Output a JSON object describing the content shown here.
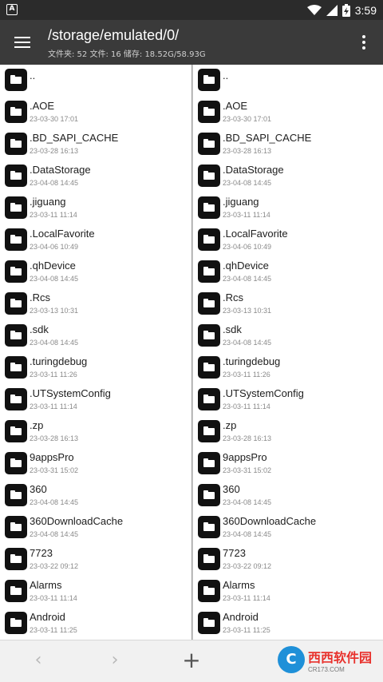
{
  "status_bar": {
    "time": "3:59",
    "left_icon": "A"
  },
  "toolbar": {
    "path": "/storage/emulated/0/",
    "info": "文件夹: 52  文件: 16  储存: 18.52G/58.93G"
  },
  "files": [
    {
      "name": "..",
      "date": ""
    },
    {
      "name": ".AOE",
      "date": "23-03-30 17:01"
    },
    {
      "name": ".BD_SAPI_CACHE",
      "date": "23-03-28 16:13"
    },
    {
      "name": ".DataStorage",
      "date": "23-04-08 14:45"
    },
    {
      "name": ".jiguang",
      "date": "23-03-11 11:14"
    },
    {
      "name": ".LocalFavorite",
      "date": "23-04-06 10:49"
    },
    {
      "name": ".qhDevice",
      "date": "23-04-08 14:45"
    },
    {
      "name": ".Rcs",
      "date": "23-03-13 10:31"
    },
    {
      "name": ".sdk",
      "date": "23-04-08 14:45"
    },
    {
      "name": ".turingdebug",
      "date": "23-03-11 11:26"
    },
    {
      "name": ".UTSystemConfig",
      "date": "23-03-11 11:14"
    },
    {
      "name": ".zp",
      "date": "23-03-28 16:13"
    },
    {
      "name": "9appsPro",
      "date": "23-03-31 15:02"
    },
    {
      "name": "360",
      "date": "23-04-08 14:45"
    },
    {
      "name": "360DownloadCache",
      "date": "23-04-08 14:45"
    },
    {
      "name": "7723",
      "date": "23-03-22 09:12"
    },
    {
      "name": "Alarms",
      "date": "23-03-11 11:14"
    },
    {
      "name": "Android",
      "date": "23-03-11 11:25"
    }
  ],
  "bottom_bar": {
    "back": "‹",
    "forward": "›",
    "add": "+"
  },
  "watermark": {
    "logo": "C",
    "main": "西西软件园",
    "sub": "CR173.COM"
  }
}
